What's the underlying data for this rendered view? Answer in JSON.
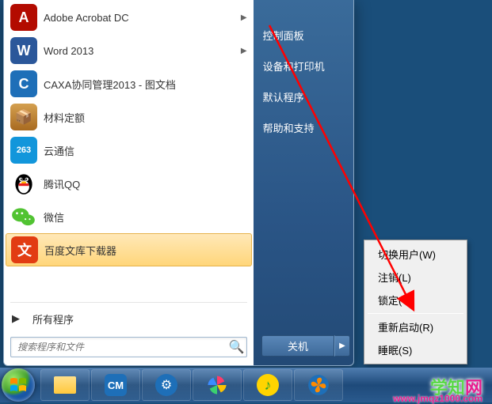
{
  "programs": [
    {
      "label": "Adobe Acrobat DC",
      "has_submenu": true,
      "icon": "acrobat"
    },
    {
      "label": "Word 2013",
      "has_submenu": true,
      "icon": "word"
    },
    {
      "label": "CAXA协同管理2013 - 图文档",
      "has_submenu": false,
      "icon": "caxa"
    },
    {
      "label": "材料定额",
      "has_submenu": false,
      "icon": "materials"
    },
    {
      "label": "云通信",
      "has_submenu": false,
      "icon": "cloud263"
    },
    {
      "label": "腾讯QQ",
      "has_submenu": false,
      "icon": "qq"
    },
    {
      "label": "微信",
      "has_submenu": false,
      "icon": "wechat"
    },
    {
      "label": "百度文库下载器",
      "has_submenu": false,
      "icon": "baidudoc",
      "selected": true
    }
  ],
  "all_programs": "所有程序",
  "search_placeholder": "搜索程序和文件",
  "right_items": [
    "控制面板",
    "设备和打印机",
    "默认程序",
    "帮助和支持"
  ],
  "shutdown_label": "关机",
  "power_menu": [
    "切换用户(W)",
    "注销(L)",
    "锁定(O)",
    "重新启动(R)",
    "睡眠(S)"
  ],
  "watermark": {
    "brand1": "学知",
    "brand2": "网",
    "url": "www.jmqz1000.com"
  }
}
